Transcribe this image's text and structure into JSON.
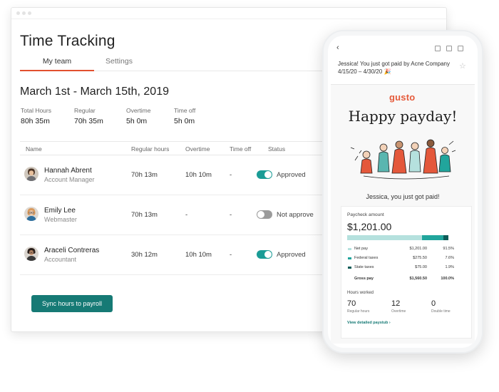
{
  "desktop": {
    "title": "Time Tracking",
    "tabs": [
      {
        "label": "My team",
        "active": true
      },
      {
        "label": "Settings",
        "active": false
      }
    ],
    "period": "March 1st - March 15th, 2019",
    "stats": [
      {
        "label": "Total Hours",
        "value": "80h 35m"
      },
      {
        "label": "Regular",
        "value": "70h 35m"
      },
      {
        "label": "Overtime",
        "value": "5h 0m"
      },
      {
        "label": "Time off",
        "value": "5h 0m"
      }
    ],
    "table": {
      "headers": [
        "Name",
        "Regular hours",
        "Overtime",
        "Time off",
        "Status"
      ],
      "rows": [
        {
          "name": "Hannah Abrent",
          "role": "Account Manager",
          "regular": "70h 13m",
          "overtime": "10h 10m",
          "timeoff": "-",
          "status": "Approved",
          "toggle_on": true
        },
        {
          "name": "Emily Lee",
          "role": "Webmaster",
          "regular": "70h 13m",
          "overtime": "-",
          "timeoff": "-",
          "status": "Not approve",
          "toggle_on": false
        },
        {
          "name": "Araceli Contreras",
          "role": "Accountant",
          "regular": "30h 12m",
          "overtime": "10h 10m",
          "timeoff": "-",
          "status": "Approved",
          "toggle_on": true
        }
      ]
    },
    "sync_button": "Sync hours to payroll",
    "colors": {
      "accent_tab": "#e2502f",
      "toggle_on": "#1a9c96",
      "button": "#167a75"
    }
  },
  "phone": {
    "back_icon": "chevron-left-icon",
    "toolbar_icons": [
      "download-icon",
      "trash-icon",
      "mail-icon"
    ],
    "subject": "Jessica! You just got paid by Acne Company 4/15/20 – 4/30/20 🎉",
    "brand": "gusto",
    "headline": "Happy payday!",
    "greeting": "Jessica, you just got paid!",
    "paycheck": {
      "label": "Paycheck amount",
      "amount": "$1,201.00",
      "breakdown": [
        {
          "label": "Net pay",
          "amount": "$1,201.00",
          "percent": "91.5%",
          "color": "#b5e1de",
          "fraction": 0.74
        },
        {
          "label": "Federal taxes",
          "amount": "$275.50",
          "percent": "7.6%",
          "color": "#21a59c",
          "fraction": 0.21
        },
        {
          "label": "State taxes",
          "amount": "$75.00",
          "percent": "1.9%",
          "color": "#0e5c58",
          "fraction": 0.05
        }
      ],
      "total": {
        "label": "Gross pay",
        "amount": "$1,560.50",
        "percent": "100.0%"
      }
    },
    "hours": {
      "label": "Hours worked",
      "items": [
        {
          "value": "70",
          "label": "Regular hours"
        },
        {
          "value": "12",
          "label": "Overtime"
        },
        {
          "value": "0",
          "label": "Double time"
        }
      ]
    },
    "paystub_link": "View detailed paystub ›"
  }
}
